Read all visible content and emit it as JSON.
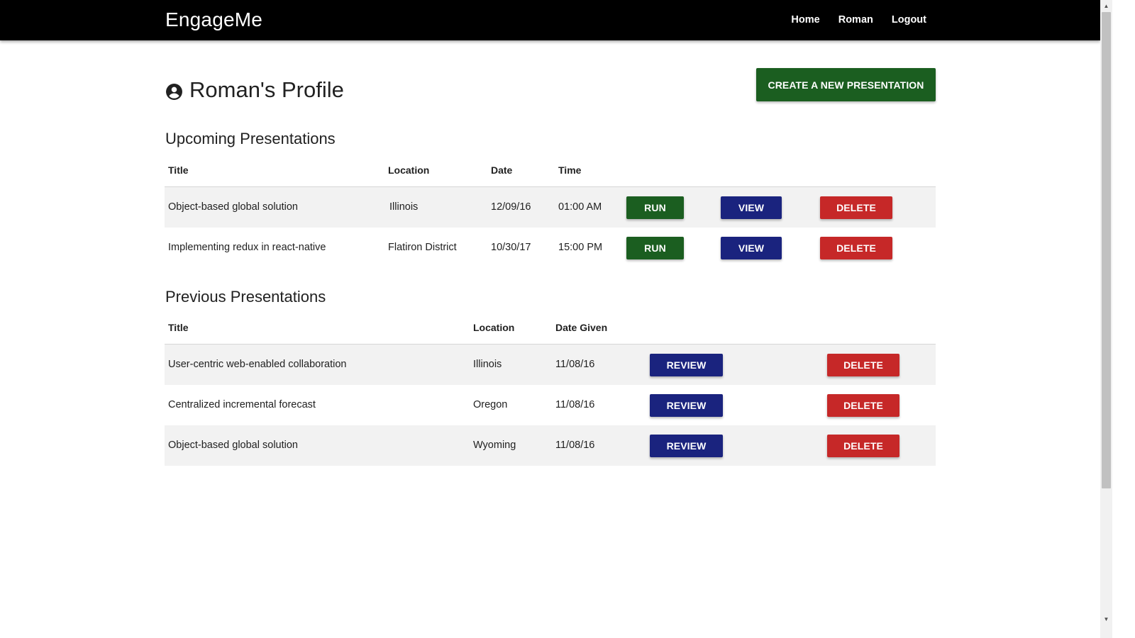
{
  "nav": {
    "brand": "EngageMe",
    "links": [
      "Home",
      "Roman",
      "Logout"
    ]
  },
  "profile": {
    "title": "Roman's Profile",
    "icon": "account-circle-icon",
    "create_button": "CREATE A NEW PRESENTATION"
  },
  "upcoming": {
    "heading": "Upcoming Presentations",
    "columns": [
      "Title",
      "Location",
      "Date",
      "Time"
    ],
    "rows": [
      {
        "title": "Object-based global solution",
        "location": "Illinois",
        "date": "12/09/16",
        "time": "01:00 AM",
        "run": "RUN",
        "view": "VIEW",
        "delete": "DELETE"
      },
      {
        "title": "Implementing redux in react-native",
        "location": "Flatiron District",
        "date": "10/30/17",
        "time": "15:00 PM",
        "run": "RUN",
        "view": "VIEW",
        "delete": "DELETE"
      }
    ]
  },
  "previous": {
    "heading": "Previous Presentations",
    "columns": [
      "Title",
      "Location",
      "Date Given"
    ],
    "rows": [
      {
        "title": "User-centric web-enabled collaboration",
        "location": "Illinois",
        "date_given": "11/08/16",
        "review": "REVIEW",
        "delete": "DELETE"
      },
      {
        "title": "Centralized incremental forecast",
        "location": "Oregon",
        "date_given": "11/08/16",
        "review": "REVIEW",
        "delete": "DELETE"
      },
      {
        "title": "Object-based global solution",
        "location": "Wyoming",
        "date_given": "11/08/16",
        "review": "REVIEW",
        "delete": "DELETE"
      }
    ]
  },
  "colors": {
    "navbar": "#000000",
    "run_create": "#1b5e20",
    "view_review": "#1a237e",
    "delete": "#c62828",
    "row_shade": "#f2f2f2"
  }
}
